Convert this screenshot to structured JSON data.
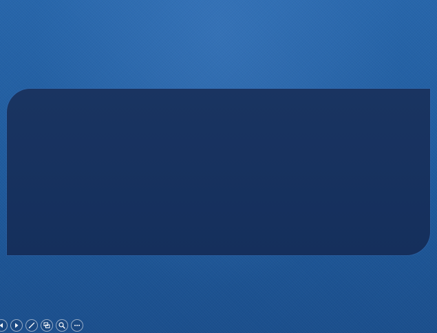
{
  "window": {
    "mode": "slide-show"
  },
  "colors": {
    "background_top": "#2766ab",
    "background_bottom": "#1b4f8d",
    "panel": "#15305e",
    "toolbar_icon": "#ffffff"
  },
  "toolbar": {
    "buttons": [
      {
        "icon": "previous-icon"
      },
      {
        "icon": "next-icon"
      },
      {
        "icon": "pen-icon"
      },
      {
        "icon": "see-all-slides-icon"
      },
      {
        "icon": "zoom-icon"
      },
      {
        "icon": "more-options-icon"
      }
    ]
  }
}
